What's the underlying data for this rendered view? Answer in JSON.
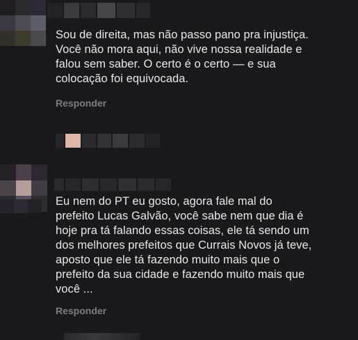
{
  "comments": [
    {
      "author": "",
      "lines": [
        "Sou de direita, mas não passo pano pra injustiça.",
        "Você não mora aqui, não vive nossa realidade e",
        "falou sem saber. O certo é o certo — e sua",
        "colocação foi equivocada."
      ],
      "reply_label": "Responder"
    },
    {
      "author": "",
      "lines": [
        "Eu nem do PT eu gosto, agora fale mal do",
        "prefeito Lucas Galvão, você sabe nem que dia é",
        "hoje pra tá falando essas coisas, ele tá sendo um",
        "dos melhores prefeitos que Currais Novos já teve,",
        "aposto que ele tá fazendo muito mais que o",
        "prefeito da sua cidade e fazendo muito mais que",
        "você ..."
      ],
      "reply_label": "Responder"
    }
  ],
  "icons": {
    "avatar": "pixelated-avatar-icon",
    "name": "pixelated-name"
  }
}
